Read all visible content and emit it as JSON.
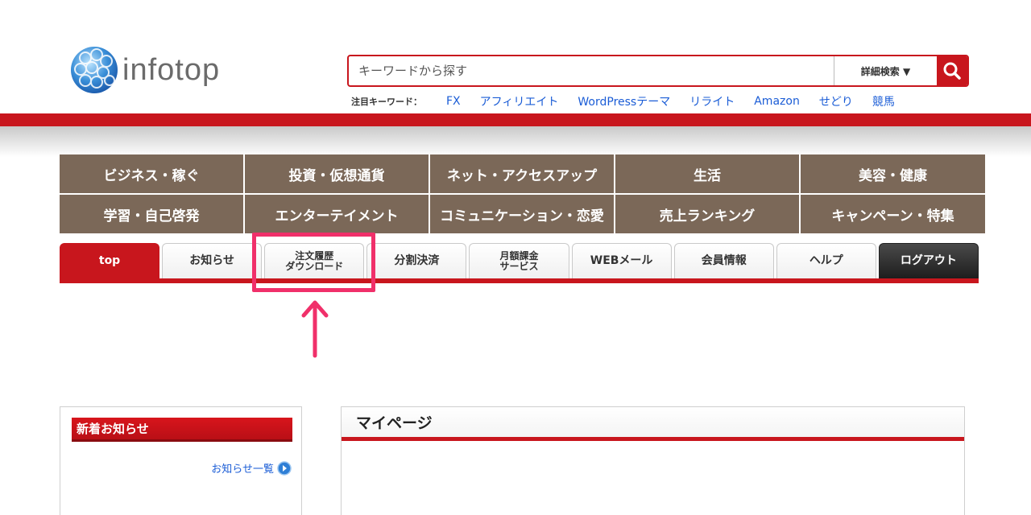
{
  "logo": {
    "text_info": "info",
    "text_top": "top"
  },
  "search": {
    "placeholder": "キーワードから探す",
    "advanced_label": "詳細検索 ▼"
  },
  "keywords": {
    "label": "注目キーワード：",
    "items": [
      "FX",
      "アフィリエイト",
      "WordPressテーマ",
      "リライト",
      "Amazon",
      "せどり",
      "競馬"
    ]
  },
  "categories": [
    "ビジネス・稼ぐ",
    "投資・仮想通貨",
    "ネット・アクセスアップ",
    "生活",
    "美容・健康",
    "学習・自己啓発",
    "エンターテイメント",
    "コミュニケーション・恋愛",
    "売上ランキング",
    "キャンペーン・特集"
  ],
  "tabs": {
    "top": "top",
    "news": "お知らせ",
    "order_line1": "注文履歴",
    "order_line2": "ダウンロード",
    "installment": "分割決済",
    "monthly_line1": "月額課金",
    "monthly_line2": "サービス",
    "webmail": "WEBメール",
    "member": "会員情報",
    "help": "ヘルプ",
    "logout": "ログアウト"
  },
  "sidebar": {
    "title": "新着お知らせ",
    "link": "お知らせ一覧"
  },
  "main": {
    "title": "マイページ"
  },
  "colors": {
    "brand_red": "#c8161d",
    "category_brown": "#7b6858",
    "highlight_pink": "#f0306a",
    "link_blue": "#1a5cd6"
  },
  "icons": {
    "globe": "globe-logo-icon",
    "search": "search-icon",
    "arrow": "arrow-up-icon",
    "circle_arrow": "circle-arrow-right-icon"
  }
}
